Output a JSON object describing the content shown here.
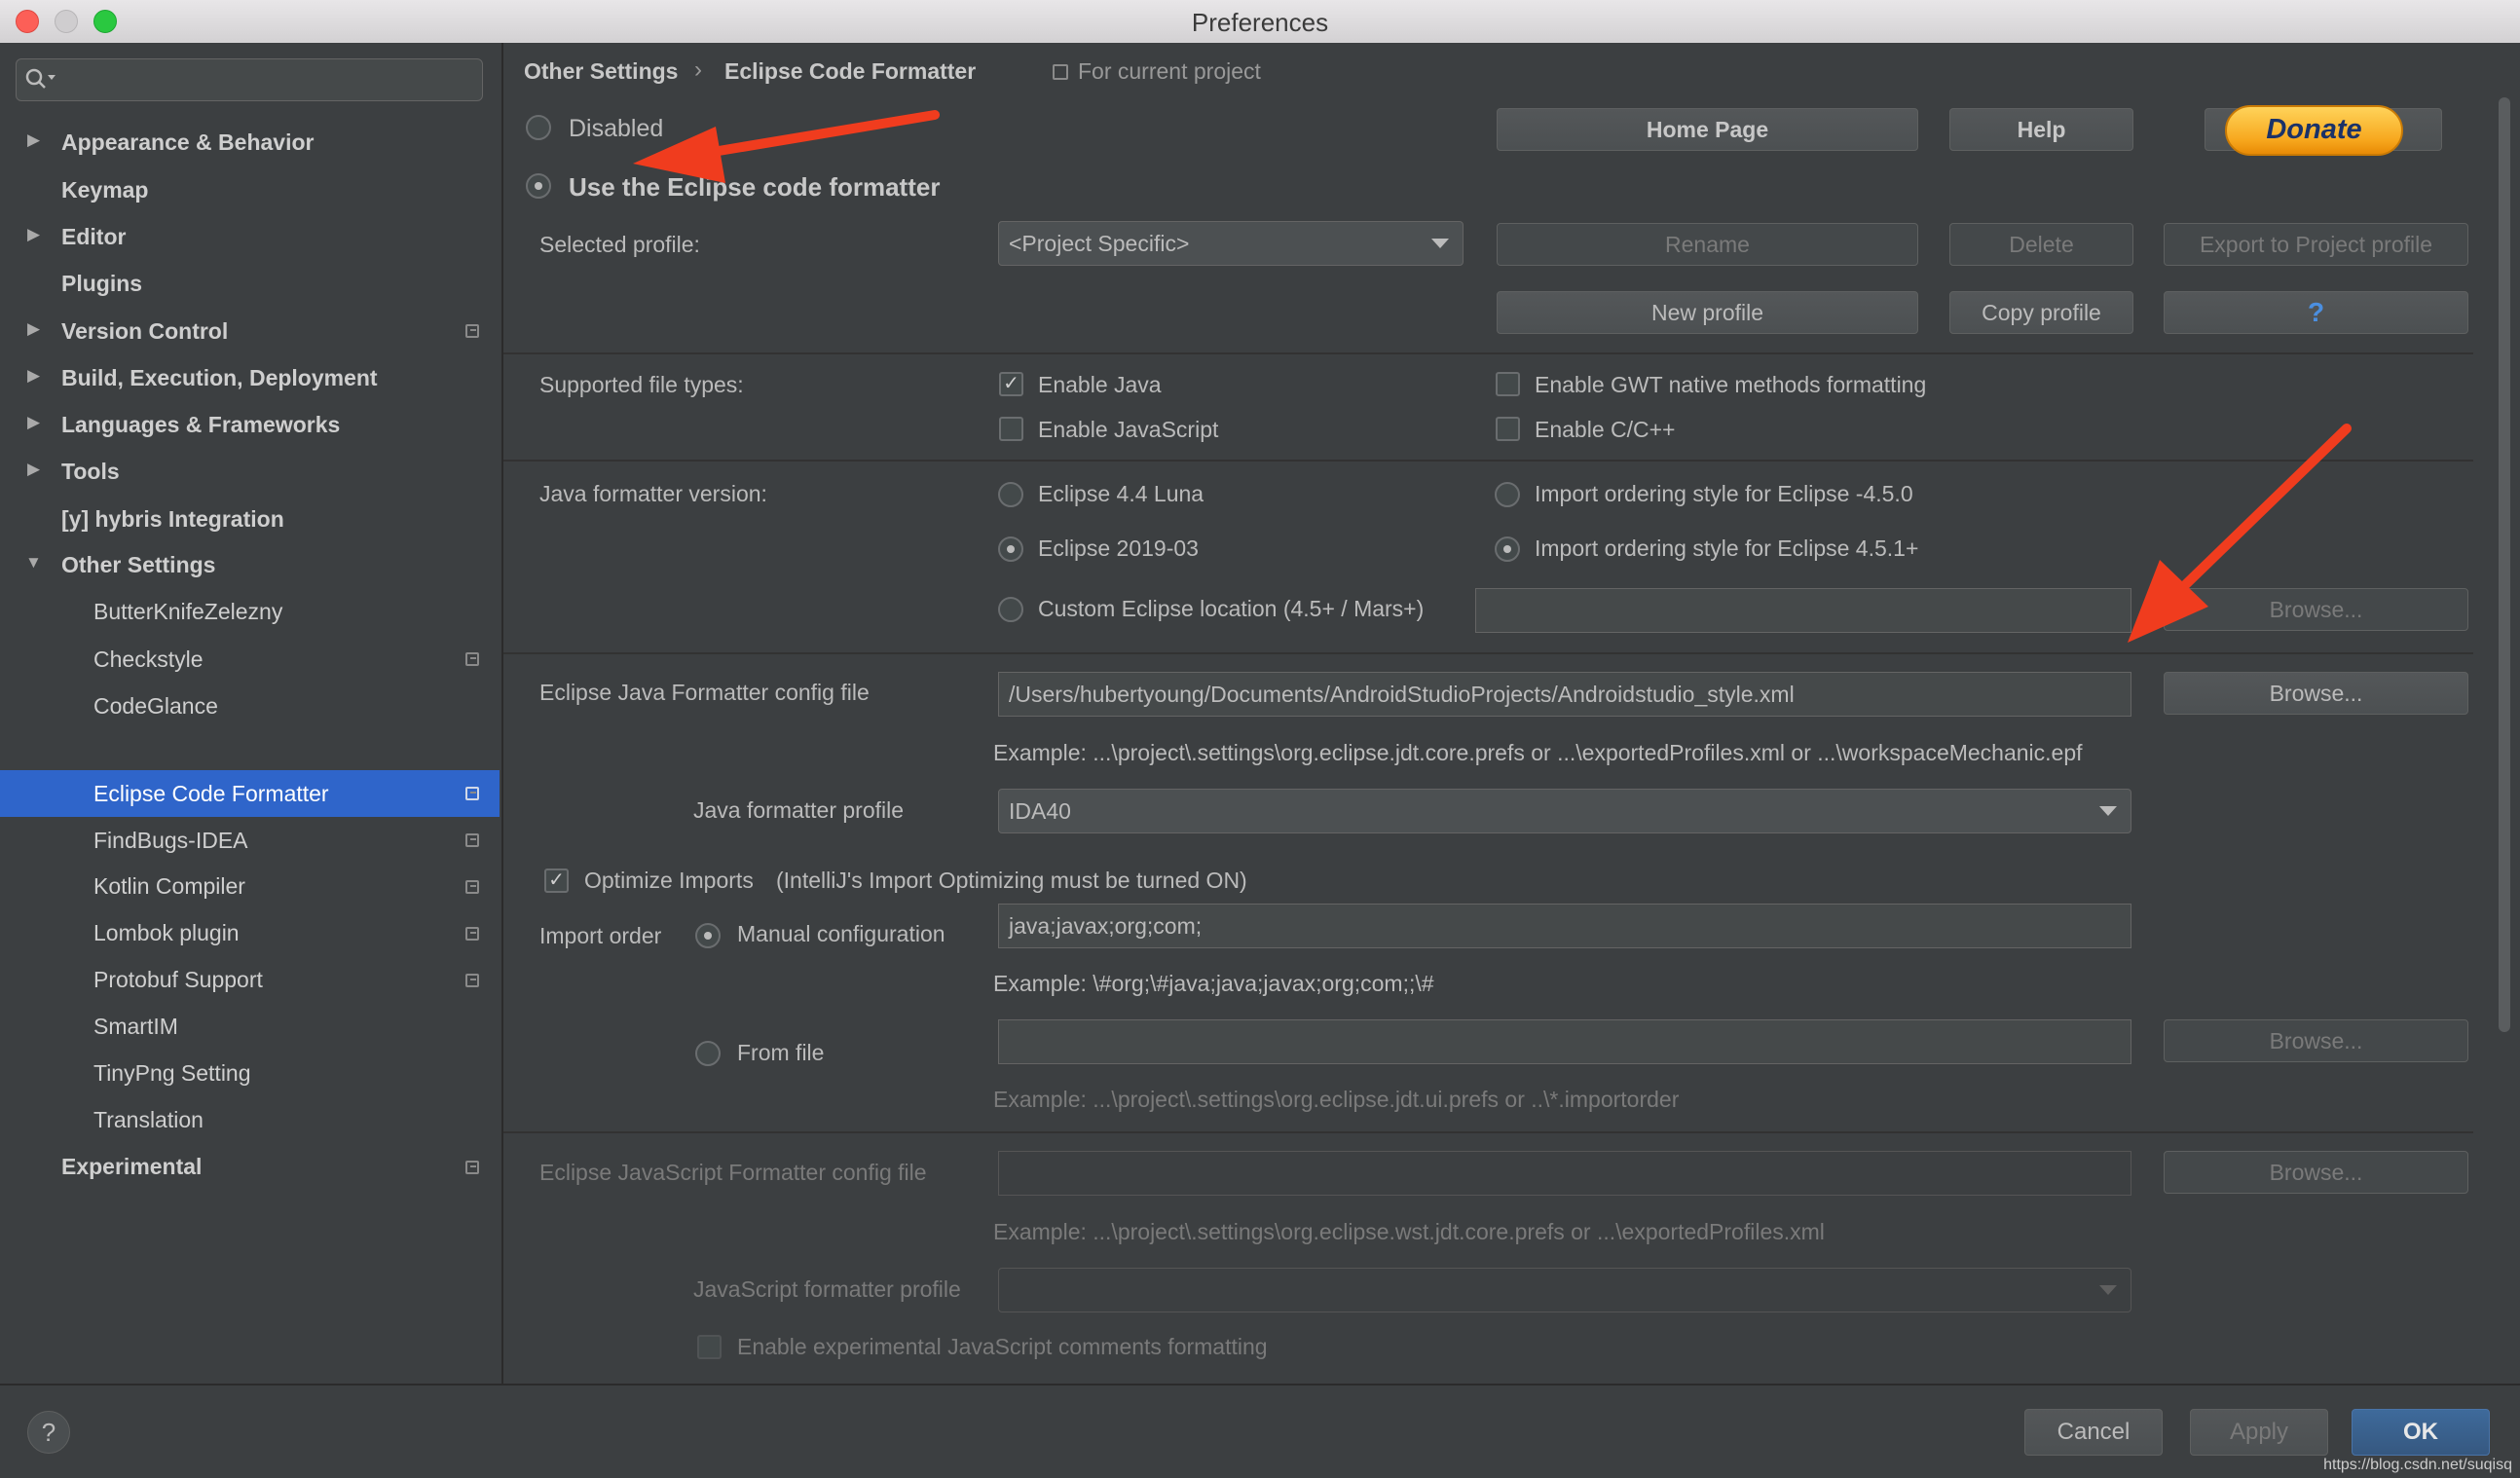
{
  "window": {
    "title": "Preferences"
  },
  "sidebar": {
    "search_placeholder": "",
    "items": [
      {
        "label": "Appearance & Behavior"
      },
      {
        "label": "Keymap"
      },
      {
        "label": "Editor"
      },
      {
        "label": "Plugins"
      },
      {
        "label": "Version Control"
      },
      {
        "label": "Build, Execution, Deployment"
      },
      {
        "label": "Languages & Frameworks"
      },
      {
        "label": "Tools"
      },
      {
        "label": "[y] hybris Integration"
      },
      {
        "label": "Other Settings"
      },
      {
        "label": "ButterKnifeZelezny"
      },
      {
        "label": "Checkstyle"
      },
      {
        "label": "CodeGlance"
      },
      {
        "label": "Eclipse Code Formatter"
      },
      {
        "label": "FindBugs-IDEA"
      },
      {
        "label": "Kotlin Compiler"
      },
      {
        "label": "Lombok plugin"
      },
      {
        "label": "Protobuf Support"
      },
      {
        "label": "SmartIM"
      },
      {
        "label": "TinyPng Setting"
      },
      {
        "label": "Translation"
      },
      {
        "label": "Experimental"
      }
    ],
    "selected": "Eclipse Code Formatter",
    "selection_color": "#2f65ca"
  },
  "breadcrumb": {
    "parent": "Other Settings",
    "separator": "›",
    "current": "Eclipse Code Formatter",
    "scope": "For current project"
  },
  "formatter": {
    "disabled_label": "Disabled",
    "use_eclipse_label": "Use the Eclipse code formatter",
    "home_page": "Home Page",
    "help": "Help",
    "donate": "Donate",
    "selected_profile_label": "Selected profile:",
    "selected_profile_value": "<Project Specific>",
    "rename": "Rename",
    "delete": "Delete",
    "export": "Export to Project profile",
    "new_profile": "New profile",
    "copy_profile": "Copy profile",
    "question": "?",
    "supported_types_label": "Supported file types:",
    "enable_java": "Enable Java",
    "enable_javascript": "Enable JavaScript",
    "enable_gwt": "Enable GWT native methods formatting",
    "enable_cpp": "Enable C/C++",
    "java_version_label": "Java formatter version:",
    "eclipse_44": "Eclipse 4.4 Luna",
    "eclipse_2019": "Eclipse 2019-03",
    "custom_location": "Custom Eclipse location (4.5+ / Mars+)",
    "import_450": "Import ordering style for Eclipse -4.5.0",
    "import_451": "Import ordering style for Eclipse 4.5.1+",
    "browse": "Browse...",
    "java_config_label": "Eclipse Java Formatter config file",
    "java_config_value": "/Users/hubertyoung/Documents/AndroidStudioProjects/Androidstudio_style.xml",
    "java_config_example": "Example: ...\\project\\.settings\\org.eclipse.jdt.core.prefs or ...\\exportedProfiles.xml or ...\\workspaceMechanic.epf",
    "java_profile_label": "Java formatter profile",
    "java_profile_value": "IDA40",
    "optimize_imports": "Optimize Imports",
    "optimize_imports_note": "(IntelliJ's Import Optimizing must be turned ON)",
    "import_order_label": "Import order",
    "manual_config": "Manual configuration",
    "import_order_value": "java;javax;org;com;",
    "import_order_example": "Example: \\#org;\\#java;java;javax;org;com;;\\#",
    "from_file": "From file",
    "from_file_example": "Example: ...\\project\\.settings\\org.eclipse.jdt.ui.prefs or ..\\*.importorder",
    "js_config_label": "Eclipse JavaScript Formatter config file",
    "js_config_example": "Example: ...\\project\\.settings\\org.eclipse.wst.jdt.core.prefs or ...\\exportedProfiles.xml",
    "js_profile_label": "JavaScript formatter profile",
    "js_comments": "Enable experimental JavaScript comments formatting"
  },
  "footer": {
    "help": "?",
    "cancel": "Cancel",
    "apply": "Apply",
    "ok": "OK",
    "ok_color": "#365880",
    "watermark": "https://blog.csdn.net/suqisq"
  },
  "annotations": {
    "arrow_color": "#f03c1e"
  }
}
